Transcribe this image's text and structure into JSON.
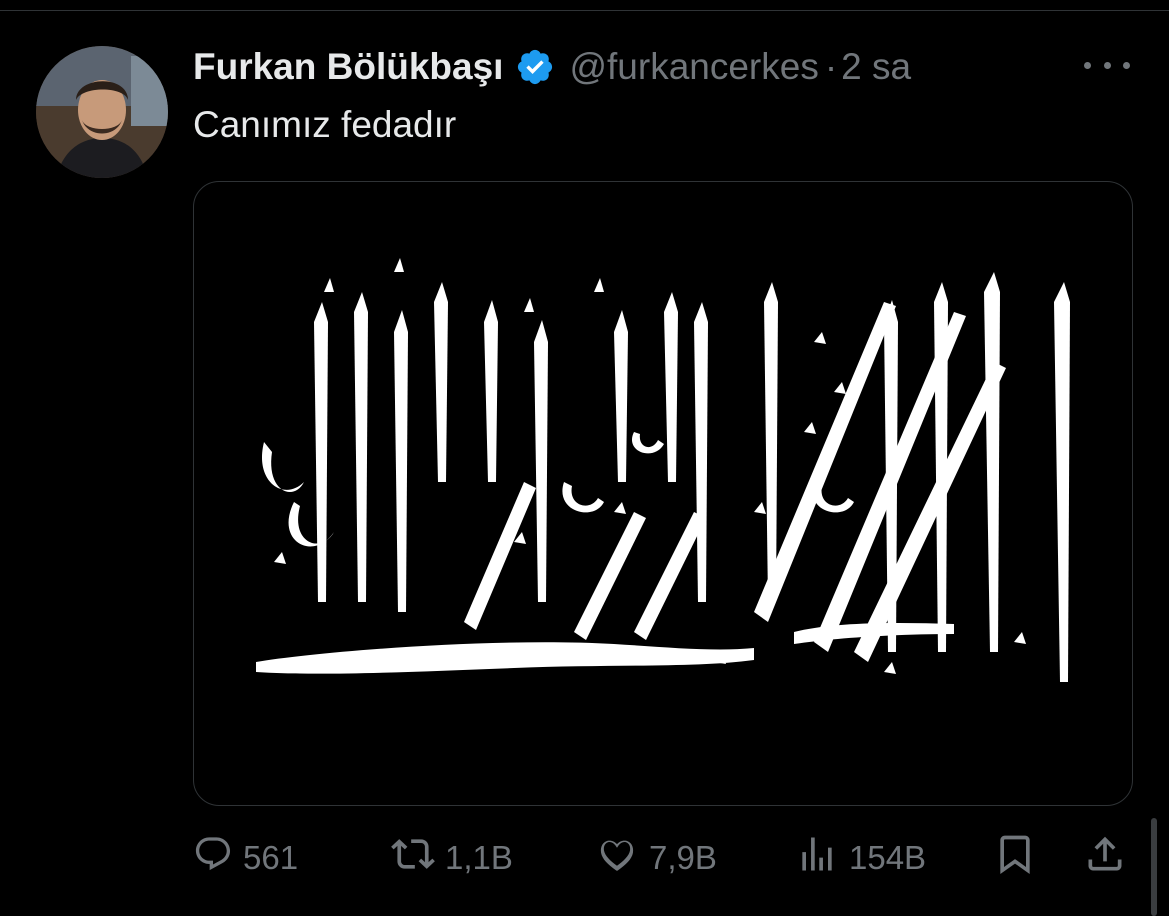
{
  "tweet": {
    "author_name": "Furkan Bölükbaşı",
    "handle": "@furkancerkes",
    "separator": "·",
    "time": "2 sa",
    "text": "Canımız fedadır",
    "verified": true
  },
  "actions": {
    "replies": "561",
    "retweets": "1,1B",
    "likes": "7,9B",
    "views": "154B"
  },
  "icons": {
    "reply": "reply-icon",
    "retweet": "retweet-icon",
    "like": "heart-icon",
    "views": "analytics-icon",
    "bookmark": "bookmark-icon",
    "share": "share-icon",
    "more": "more-icon",
    "verified": "verified-badge-icon"
  },
  "colors": {
    "background": "#000000",
    "text": "#e7e9ea",
    "muted": "#71767b",
    "verified_blue": "#1d9bf0",
    "calligraphy": "#ffffff"
  }
}
